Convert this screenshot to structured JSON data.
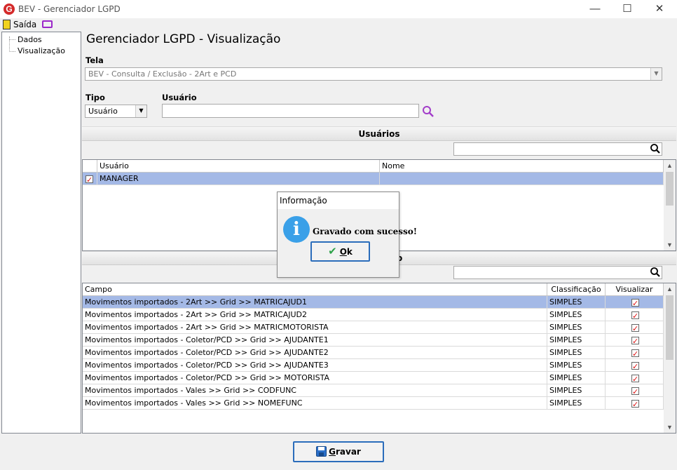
{
  "window": {
    "title": "BEV - Gerenciador LGPD",
    "minimize": "—",
    "maximize": "☐",
    "close": "✕"
  },
  "toolbar": {
    "exit_label": "Saída"
  },
  "tree": {
    "items": [
      "Dados",
      "Visualização"
    ]
  },
  "page": {
    "title": "Gerenciador LGPD - Visualização"
  },
  "tela": {
    "label": "Tela",
    "value": "BEV - Consulta / Exclusão - 2Art e PCD"
  },
  "tipo": {
    "label": "Tipo",
    "value": "Usuário"
  },
  "usuario": {
    "label": "Usuário",
    "value": ""
  },
  "users_section": {
    "header": "Usuários",
    "columns": [
      "Usuário",
      "Nome"
    ],
    "rows": [
      {
        "usuario": "MANAGER",
        "nome": "",
        "checked": true,
        "selected": true
      }
    ]
  },
  "fields_section": {
    "header_fragment": "o",
    "columns": [
      "Campo",
      "Classificação",
      "Visualizar"
    ],
    "rows": [
      {
        "campo": "Movimentos importados - 2Art >> Grid >> MATRICAJUD1",
        "classificacao": "SIMPLES",
        "visualizar": true,
        "selected": true
      },
      {
        "campo": "Movimentos importados - 2Art >> Grid >> MATRICAJUD2",
        "classificacao": "SIMPLES",
        "visualizar": true
      },
      {
        "campo": "Movimentos importados - 2Art >> Grid >> MATRICMOTORISTA",
        "classificacao": "SIMPLES",
        "visualizar": true
      },
      {
        "campo": "Movimentos importados - Coletor/PCD >> Grid >> AJUDANTE1",
        "classificacao": "SIMPLES",
        "visualizar": true
      },
      {
        "campo": "Movimentos importados - Coletor/PCD >> Grid >> AJUDANTE2",
        "classificacao": "SIMPLES",
        "visualizar": true
      },
      {
        "campo": "Movimentos importados - Coletor/PCD >> Grid >> AJUDANTE3",
        "classificacao": "SIMPLES",
        "visualizar": true
      },
      {
        "campo": "Movimentos importados - Coletor/PCD >> Grid >> MOTORISTA",
        "classificacao": "SIMPLES",
        "visualizar": true
      },
      {
        "campo": "Movimentos importados - Vales >> Grid >> CODFUNC",
        "classificacao": "SIMPLES",
        "visualizar": true
      },
      {
        "campo": "Movimentos importados - Vales >> Grid >> NOMEFUNC",
        "classificacao": "SIMPLES",
        "visualizar": true
      }
    ]
  },
  "dialog": {
    "title": "Informação",
    "message": "Gravado com sucesso!",
    "ok_label": "k",
    "ok_underline": "O",
    "icon": "info-icon"
  },
  "save_button": {
    "underline": "G",
    "label": "ravar",
    "icon": "floppy-disk-icon"
  },
  "colors": {
    "selection": "#a4b9e6",
    "accent": "#2b6dbb",
    "check": "#d11111"
  }
}
